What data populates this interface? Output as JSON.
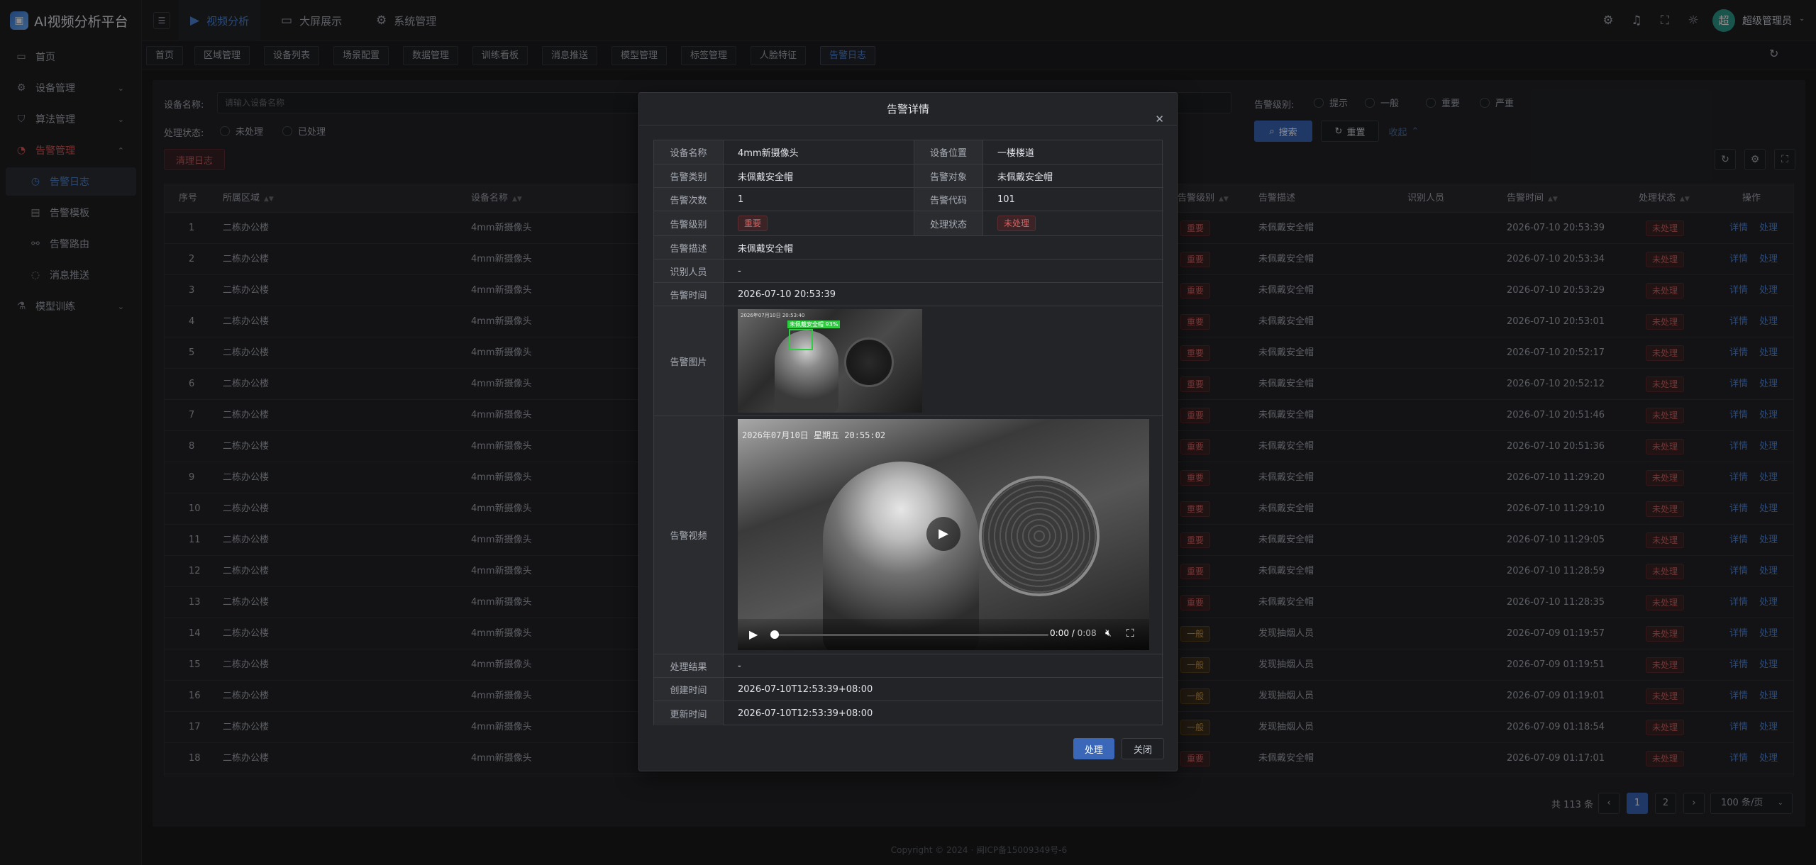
{
  "app": {
    "title": "AI视频分析平台"
  },
  "sidebar": {
    "items": [
      {
        "label": "首页",
        "icon": "monitor-icon"
      },
      {
        "label": "设备管理",
        "icon": "gear-icon"
      },
      {
        "label": "算法管理",
        "icon": "shield-icon"
      },
      {
        "label": "告警管理",
        "icon": "alarm-icon"
      },
      {
        "label": "告警日志",
        "icon": "clock-icon"
      },
      {
        "label": "告警模板",
        "icon": "document-icon"
      },
      {
        "label": "告警路由",
        "icon": "link-icon"
      },
      {
        "label": "消息推送",
        "icon": "message-icon"
      },
      {
        "label": "模型训练",
        "icon": "flask-icon"
      }
    ]
  },
  "topbar": {
    "menus": [
      {
        "label": "视频分析",
        "icon": "video-icon"
      },
      {
        "label": "大屏展示",
        "icon": "screen-icon"
      },
      {
        "label": "系统管理",
        "icon": "gear-icon"
      }
    ],
    "avatar_initial": "超",
    "user_name": "超级管理员"
  },
  "tabs": [
    "首页",
    "区域管理",
    "设备列表",
    "场景配置",
    "数据管理",
    "训练看板",
    "消息推送",
    "模型管理",
    "标签管理",
    "人脸特征",
    "告警日志"
  ],
  "search": {
    "device_name_label": "设备名称:",
    "device_name_placeholder": "请输入设备名称",
    "level_label": "告警级别:",
    "levels": [
      "提示",
      "一般",
      "重要",
      "严重"
    ],
    "status_label": "处理状态:",
    "statuses": [
      "未处理",
      "已处理"
    ],
    "search_btn": "搜索",
    "reset_btn": "重置",
    "collapse_btn": "收起",
    "clear_btn": "清理日志"
  },
  "table": {
    "headers": {
      "index": "序号",
      "area": "所属区域",
      "device": "设备名称",
      "level": "告警级别",
      "desc": "告警描述",
      "person": "识别人员",
      "time": "告警时间",
      "status": "处理状态",
      "ops": "操作"
    },
    "op_detail": "详情",
    "op_process": "处理",
    "rows": [
      {
        "i": "1",
        "area": "二栋办公楼",
        "device": "4mm新摄像头",
        "level": "重要",
        "desc": "未佩戴安全帽",
        "time": "2026-07-10 20:53:39",
        "status": "未处理"
      },
      {
        "i": "2",
        "area": "二栋办公楼",
        "device": "4mm新摄像头",
        "level": "重要",
        "desc": "未佩戴安全帽",
        "time": "2026-07-10 20:53:34",
        "status": "未处理"
      },
      {
        "i": "3",
        "area": "二栋办公楼",
        "device": "4mm新摄像头",
        "level": "重要",
        "desc": "未佩戴安全帽",
        "time": "2026-07-10 20:53:29",
        "status": "未处理"
      },
      {
        "i": "4",
        "area": "二栋办公楼",
        "device": "4mm新摄像头",
        "level": "重要",
        "desc": "未佩戴安全帽",
        "time": "2026-07-10 20:53:01",
        "status": "未处理"
      },
      {
        "i": "5",
        "area": "二栋办公楼",
        "device": "4mm新摄像头",
        "level": "重要",
        "desc": "未佩戴安全帽",
        "time": "2026-07-10 20:52:17",
        "status": "未处理"
      },
      {
        "i": "6",
        "area": "二栋办公楼",
        "device": "4mm新摄像头",
        "level": "重要",
        "desc": "未佩戴安全帽",
        "time": "2026-07-10 20:52:12",
        "status": "未处理"
      },
      {
        "i": "7",
        "area": "二栋办公楼",
        "device": "4mm新摄像头",
        "level": "重要",
        "desc": "未佩戴安全帽",
        "time": "2026-07-10 20:51:46",
        "status": "未处理"
      },
      {
        "i": "8",
        "area": "二栋办公楼",
        "device": "4mm新摄像头",
        "level": "重要",
        "desc": "未佩戴安全帽",
        "time": "2026-07-10 20:51:36",
        "status": "未处理"
      },
      {
        "i": "9",
        "area": "二栋办公楼",
        "device": "4mm新摄像头",
        "level": "重要",
        "desc": "未佩戴安全帽",
        "time": "2026-07-10 11:29:20",
        "status": "未处理"
      },
      {
        "i": "10",
        "area": "二栋办公楼",
        "device": "4mm新摄像头",
        "level": "重要",
        "desc": "未佩戴安全帽",
        "time": "2026-07-10 11:29:10",
        "status": "未处理"
      },
      {
        "i": "11",
        "area": "二栋办公楼",
        "device": "4mm新摄像头",
        "level": "重要",
        "desc": "未佩戴安全帽",
        "time": "2026-07-10 11:29:05",
        "status": "未处理"
      },
      {
        "i": "12",
        "area": "二栋办公楼",
        "device": "4mm新摄像头",
        "level": "重要",
        "desc": "未佩戴安全帽",
        "time": "2026-07-10 11:28:59",
        "status": "未处理"
      },
      {
        "i": "13",
        "area": "二栋办公楼",
        "device": "4mm新摄像头",
        "level": "重要",
        "desc": "未佩戴安全帽",
        "time": "2026-07-10 11:28:35",
        "status": "未处理"
      },
      {
        "i": "14",
        "area": "二栋办公楼",
        "device": "4mm新摄像头",
        "level": "一般",
        "desc": "发现抽烟人员",
        "time": "2026-07-09 01:19:57",
        "status": "未处理"
      },
      {
        "i": "15",
        "area": "二栋办公楼",
        "device": "4mm新摄像头",
        "level": "一般",
        "desc": "发现抽烟人员",
        "time": "2026-07-09 01:19:51",
        "status": "未处理"
      },
      {
        "i": "16",
        "area": "二栋办公楼",
        "device": "4mm新摄像头",
        "level": "一般",
        "desc": "发现抽烟人员",
        "time": "2026-07-09 01:19:01",
        "status": "未处理"
      },
      {
        "i": "17",
        "area": "二栋办公楼",
        "device": "4mm新摄像头",
        "level": "一般",
        "desc": "发现抽烟人员",
        "time": "2026-07-09 01:18:54",
        "status": "未处理"
      },
      {
        "i": "18",
        "area": "二栋办公楼",
        "device": "4mm新摄像头",
        "level": "重要",
        "desc": "未佩戴安全帽",
        "time": "2026-07-09 01:17:01",
        "status": "未处理"
      }
    ]
  },
  "pager": {
    "total": "共 113 条",
    "pages": [
      "1",
      "2"
    ],
    "size": "100 条/页"
  },
  "copyright": "Copyright © 2024 · 闽ICP备15009349号-6",
  "modal": {
    "title": "告警详情",
    "fields": {
      "device_name_l": "设备名称",
      "device_name": "4mm新摄像头",
      "location_l": "设备位置",
      "location": "一楼楼道",
      "type_l": "告警类别",
      "type": "未佩戴安全帽",
      "object_l": "告警对象",
      "object": "未佩戴安全帽",
      "count_l": "告警次数",
      "count": "1",
      "code_l": "告警代码",
      "code": "101",
      "level_l": "告警级别",
      "level": "重要",
      "status_l": "处理状态",
      "status": "未处理",
      "desc_l": "告警描述",
      "desc": "未佩戴安全帽",
      "person_l": "识别人员",
      "person": "-",
      "time_l": "告警时间",
      "time": "2026-07-10 20:53:39",
      "image_l": "告警图片",
      "video_l": "告警视频",
      "result_l": "处理结果",
      "result": "-",
      "created_l": "创建时间",
      "created": "2026-07-10T12:53:39+08:00",
      "updated_l": "更新时间",
      "updated": "2026-07-10T12:53:39+08:00"
    },
    "image_bbox_label": "未佩戴安全帽 93%",
    "image_ts": "2026年07月10日 20:53:40",
    "video_ts": "2026年07月10日 星期五 20:55:02",
    "video_time": "0:00",
    "video_duration": "0:08",
    "process_btn": "处理",
    "close_btn": "关闭"
  },
  "colors": {
    "accent": "#3a67b8",
    "danger": "#d36565",
    "warning": "#d09a43"
  }
}
